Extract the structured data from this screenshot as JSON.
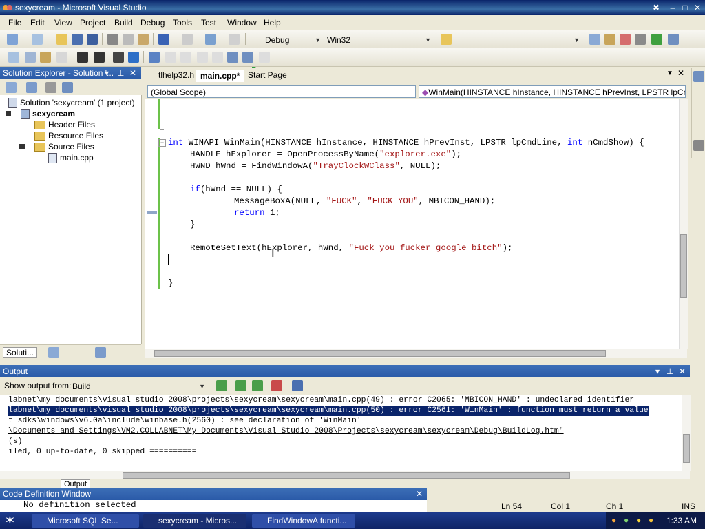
{
  "window": {
    "title": "sexycream - Microsoft Visual Studio"
  },
  "menu": [
    "File",
    "Edit",
    "View",
    "Project",
    "Build",
    "Debug",
    "Tools",
    "Test",
    "Window",
    "Help"
  ],
  "toolbar": {
    "config": "Debug",
    "platform": "Win32"
  },
  "solution_explorer": {
    "title": "Solution Explorer - Solution '...",
    "solution_label": "Solution 'sexycream' (1 project)",
    "project": "sexycream",
    "folders": [
      "Header Files",
      "Resource Files",
      "Source Files"
    ],
    "file": "main.cpp",
    "bottom_tab": "Soluti..."
  },
  "editor": {
    "tabs": [
      "tlhelp32.h",
      "main.cpp*",
      "Start Page"
    ],
    "scope": "(Global Scope)",
    "function": "WinMain(HINSTANCE hInstance, HINSTANCE hPrevInst, LPSTR lpCmdLine,",
    "code": {
      "l1a": "int",
      "l1b": " WINAPI WinMain(HINSTANCE hInstance, HINSTANCE hPrevInst, LPSTR lpCmdLine, ",
      "l1c": "int",
      "l1d": " nCmdShow) {",
      "l2a": "HANDLE hExplorer = OpenProcessByName(",
      "l2b": "\"explorer.exe\"",
      "l2c": ");",
      "l3a": "HWND hWnd = FindWindowA(",
      "l3b": "\"TrayClockWClass\"",
      "l3c": ", NULL);",
      "l4a": "if",
      "l4b": "(hWnd == NULL) {",
      "l5a": "MessageBoxA(NULL, ",
      "l5b": "\"FUCK\"",
      "l5c": ", ",
      "l5d": "\"FUCK YOU\"",
      "l5e": ", MBICON_HAND);",
      "l6a": "return",
      "l6b": " 1;",
      "l7": "}",
      "l8a": "RemoteSetText(hExplorer, hWnd, ",
      "l8b": "\"Fuck you fucker google bitch\"",
      "l8c": ");",
      "l9": "}"
    }
  },
  "output": {
    "title": "Output",
    "show_from_label": "Show output from:",
    "source": "Build",
    "lines": [
      "labnet\\my documents\\visual studio 2008\\projects\\sexycream\\sexycream\\main.cpp(49) : error C2065: 'MBICON_HAND' : undeclared identifier",
      "labnet\\my documents\\visual studio 2008\\projects\\sexycream\\sexycream\\main.cpp(50) : error C2561: 'WinMain' : function must return a value",
      "t sdks\\windows\\v6.0a\\include\\winbase.h(2560) : see declaration of 'WinMain'",
      "\\Documents and Settings\\VM2.COLLABNET\\My Documents\\Visual Studio 2008\\Projects\\sexycream\\sexycream\\Debug\\BuildLog.htm\"",
      "(s)",
      "iled, 0 up-to-date, 0 skipped =========="
    ],
    "bottom_tab": "Output"
  },
  "code_definition": {
    "title": "Code Definition Window",
    "text": "No definition selected"
  },
  "status": {
    "ln": "Ln 54",
    "col": "Col 1",
    "ch": "Ch 1",
    "ins": "INS"
  },
  "taskbar": {
    "items": [
      "Microsoft SQL Se...",
      "sexycream - Micros...",
      "FindWindowA functi..."
    ],
    "time": "1:33 AM"
  }
}
